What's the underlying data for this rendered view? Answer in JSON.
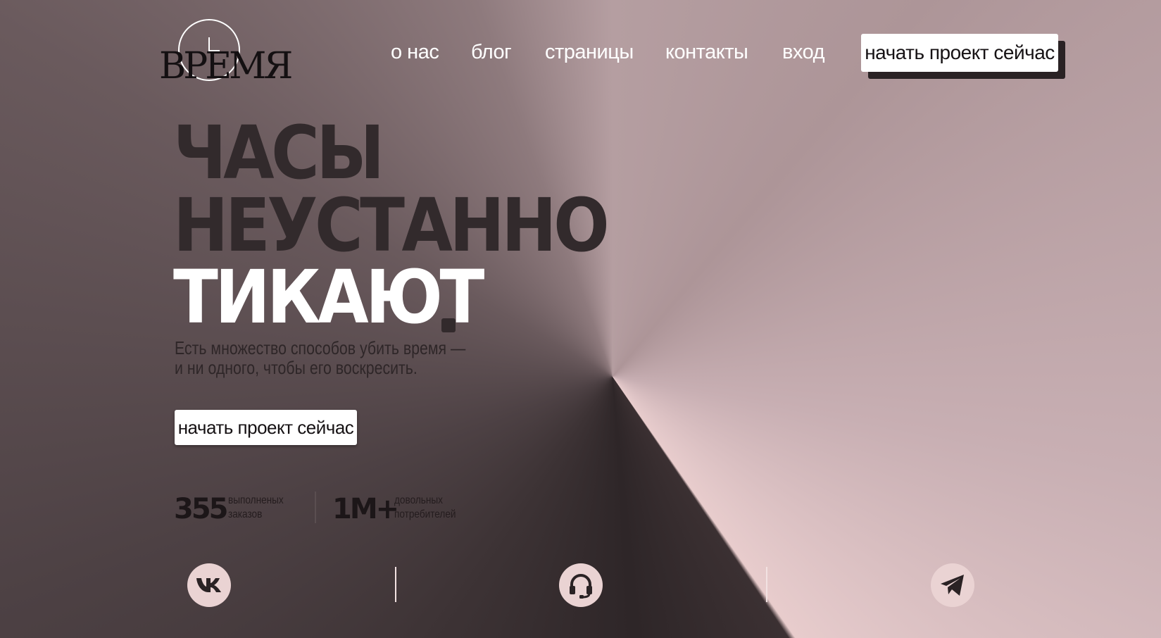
{
  "brand": {
    "logo_text": "ВРЕМЯ"
  },
  "nav": {
    "items": [
      {
        "label": "о нас"
      },
      {
        "label": "блог"
      },
      {
        "label": "страницы"
      },
      {
        "label": "контакты"
      },
      {
        "label": "вход"
      }
    ],
    "cta_label": "начать проект сейчас"
  },
  "hero": {
    "line1": "ЧАСЫ",
    "line2": "НЕУСТАННО",
    "line3": "ТИКАЮТ",
    "subtitle_line1": "Есть множество способов убить время —",
    "subtitle_line2": "и ни одного, чтобы его воскресить.",
    "cta_label": "начать проект сейчас"
  },
  "stats": [
    {
      "value": "355",
      "label_line1": "выполненых",
      "label_line2": "заказов"
    },
    {
      "value": "1М+",
      "label_line1": "довольных",
      "label_line2": "потребителей"
    }
  ],
  "social": [
    {
      "icon": "vk-icon"
    },
    {
      "icon": "headphones-icon"
    },
    {
      "icon": "telegram-icon"
    }
  ],
  "colors": {
    "dark": "#322a2c",
    "white": "#ffffff",
    "pink": "#ead3d3"
  }
}
